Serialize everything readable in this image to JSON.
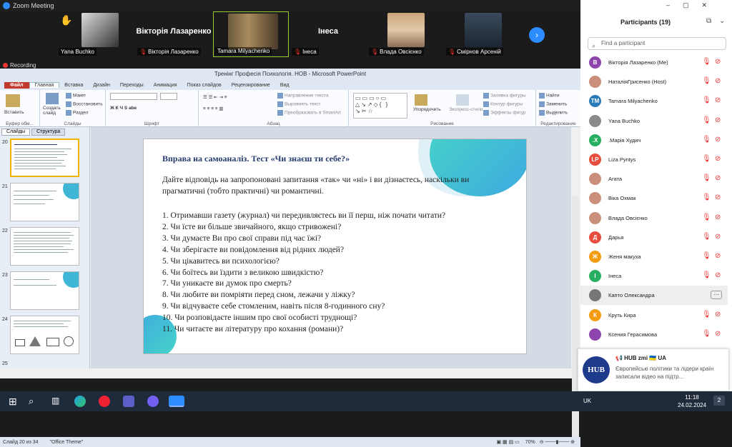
{
  "zoom": {
    "title": "Zoom Meeting",
    "recording": "Recording"
  },
  "video_tiles": [
    {
      "caption": "Yana Buchko",
      "muted": false
    },
    {
      "big_name": "Вікторія Лазаренко",
      "caption": "Вікторія Лазаренко",
      "muted": true
    },
    {
      "caption": "Tamara Milyachenko",
      "muted": false
    },
    {
      "big_name": "Інеса",
      "caption": "Інеса",
      "muted": true
    },
    {
      "caption": "Влада Овсієнко",
      "muted": true
    },
    {
      "caption": "Смірнов Арсеній",
      "muted": true
    }
  ],
  "ppt": {
    "window_title": "Тренінг Професія Психологія. НОВ  -  Microsoft PowerPoint",
    "tabs": [
      "Файл",
      "Главная",
      "Вставка",
      "Дизайн",
      "Переходы",
      "Анимация",
      "Показ слайдов",
      "Рецензирование",
      "Вид"
    ],
    "active_tab": "Главная",
    "ribbon": {
      "paste": "Вставить",
      "create_slide": "Создать слайд",
      "layout": "Макет",
      "restore": "Восстановить",
      "section": "Раздел",
      "text_direction": "Направление текста",
      "align_text": "Выровнять текст",
      "convert_smartart": "Преобразовать в SmartArt",
      "arrange": "Упорядочить",
      "quick_styles": "Экспресс-стили",
      "shape_fill": "Заливка фигуры",
      "shape_outline": "Контур фигуры",
      "shape_effects": "Эффекты фигур",
      "find": "Найти",
      "replace": "Заменить",
      "select": "Выделить",
      "groups": [
        "Буфер обм...",
        "Слайды",
        "Шрифт",
        "Абзац",
        "Рисование",
        "Редактирование"
      ]
    },
    "pane_tabs": [
      "Слайды",
      "Структура"
    ],
    "thumbnails": [
      20,
      21,
      22,
      23,
      24,
      25
    ],
    "status": {
      "slide_info": "Слайд 20 из 34",
      "theme": "\"Office Theme\"",
      "zoom": "70%"
    }
  },
  "slide": {
    "title": "Вправа на самоаналіз. Тест «Чи знаєш ти себе?»",
    "intro": "Дайте відповідь на запропоновані запитання «так» чи «ні» і ви дізнаєтесь, наскільки ви прагматичні (тобто практичні) чи романтичні.",
    "questions": [
      "1. Отримавши газету (журнал) чи передивляєтесь ви її перш, ніж почати читати?",
      "2. Чи їсте ви більше звичайного, якщо стривожені?",
      "3. Чи думаєте Ви про свої справи під час їжі?",
      "4. Чи зберігаєте ви повідомлення від рідних людей?",
      "5. Чи цікавитесь ви психологією?",
      "6. Чи боїтесь ви їздити з великою швидкістю?",
      "7. Чи уникаєте ви думок про смерть?",
      "8. Чи любите ви помріяти перед сном, лежачи у ліжку?",
      "9. Чи відчуваєте себе стомленим, навіть після 8-годинного сну?",
      "10. Чи розповідаєте іншим про свої особисті труднощі?",
      "11. Чи читаєте ви літературу про кохання (романи)?"
    ]
  },
  "participants": {
    "title": "Participants (19)",
    "search_placeholder": "Find a participant",
    "list": [
      {
        "initials": "В",
        "name": "Вікторія Лазаренко (Me)",
        "color": "#8e44ad"
      },
      {
        "initials": "",
        "name": "НаталіяГрисенко (Host)",
        "color": "#c98f7a"
      },
      {
        "initials": "TM",
        "name": "Tamara Milyachenko",
        "color": "#2b7bb9"
      },
      {
        "initials": "",
        "name": "Yana Buchko",
        "color": "#8a8a8a"
      },
      {
        "initials": ".X",
        "name": ".Марія Худич",
        "color": "#27ae60"
      },
      {
        "initials": "LP",
        "name": "Liza Pyntys",
        "color": "#e74c3c"
      },
      {
        "initials": "",
        "name": "Агата",
        "color": "#c98f7a"
      },
      {
        "initials": "",
        "name": "Віка Охмак",
        "color": "#c98f7a"
      },
      {
        "initials": "",
        "name": "Влада Овсієнко",
        "color": "#c98f7a"
      },
      {
        "initials": "Д",
        "name": "Дарья",
        "color": "#e74c3c"
      },
      {
        "initials": "Ж",
        "name": "Женя макуха",
        "color": "#f39c12"
      },
      {
        "initials": "І",
        "name": "Інеса",
        "color": "#27ae60"
      },
      {
        "initials": "",
        "name": "Капто Олександра",
        "color": "#777"
      },
      {
        "initials": "К",
        "name": "Круть Кира",
        "color": "#f39c12"
      },
      {
        "initials": "",
        "name": "Ксения Герасимова",
        "color": "#8e44ad"
      }
    ]
  },
  "notification": {
    "source": "HUB zmi",
    "title": "📢 HUB zmi 🇺🇦 UA",
    "text": "Європейські політики та лідери країн записали відео на підтр..."
  },
  "taskbar": {
    "lang": "UK",
    "time": "11:18",
    "date": "24.02.2024",
    "badge": "2"
  }
}
